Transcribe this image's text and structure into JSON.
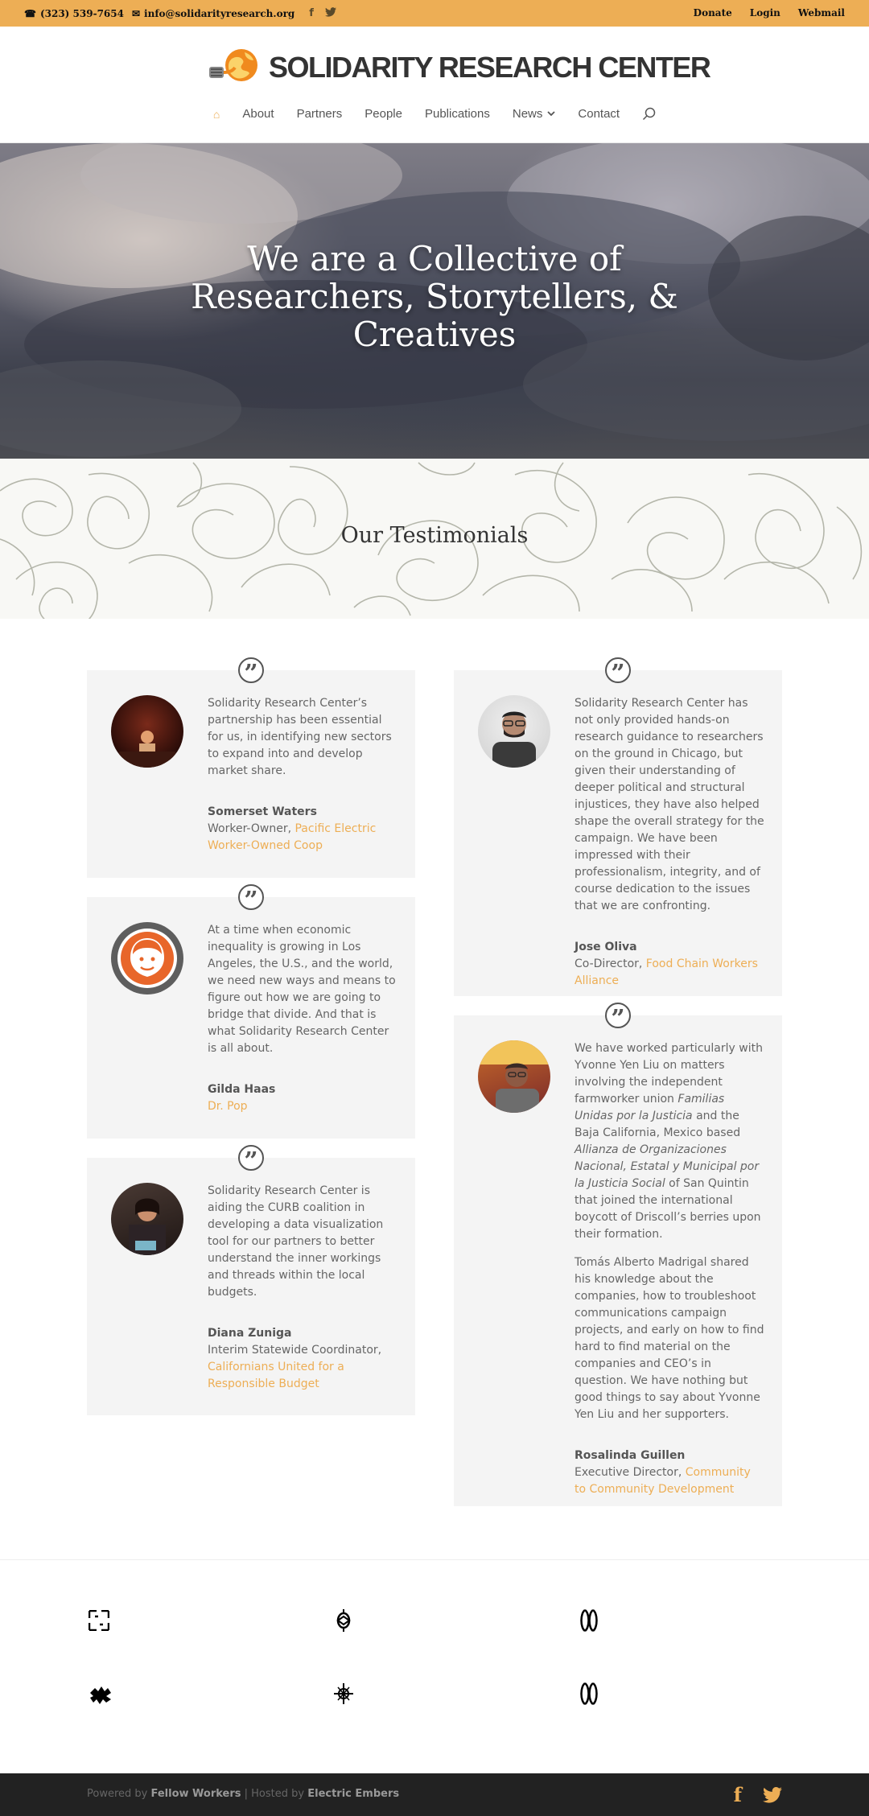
{
  "topbar": {
    "phone": "(323) 539-7654",
    "email": "info@solidarityresearch.org",
    "links": {
      "donate": "Donate",
      "login": "Login",
      "webmail": "Webmail"
    }
  },
  "logo": {
    "text": "SOLIDARITY RESEARCH CENTER",
    "icon": "lightbulb-globe-icon"
  },
  "nav": {
    "home_icon": "home-icon",
    "items": [
      "About",
      "Partners",
      "People",
      "Publications",
      "News",
      "Contact"
    ],
    "search_icon": "search-icon"
  },
  "hero": {
    "line1": "We are a Collective of",
    "line2": "Researchers, Storytellers, &",
    "line3": "Creatives"
  },
  "section_title": "Our Testimonials",
  "testimonials": [
    {
      "quote": "Solidarity Research Center’s partnership has been essential for us, in identifying new sectors to expand into and develop market share.",
      "name": "Somerset Waters",
      "role": "Worker-Owner, ",
      "org": "Pacific Electric Worker-Owned Coop"
    },
    {
      "quote": "At a time when economic inequality is growing in Los Angeles, the U.S., and the world, we need new ways and means to figure out how we are going to bridge that divide.  And that is what Solidarity Research Center is all about.",
      "name": "Gilda Haas",
      "role": "",
      "org": "Dr. Pop"
    },
    {
      "quote": "Solidarity Research Center is aiding the CURB coalition in developing a data visualization tool for our partners to better understand the inner workings and threads within the local budgets.",
      "name": "Diana Zuniga",
      "role": "Interim Statewide Coordinator, ",
      "org": "Californians United for a Responsible Budget"
    },
    {
      "quote": "Solidarity Research Center has not only provided hands-on research guidance to researchers on the ground in Chicago, but given their understanding of deeper political and structural injustices, they have also helped shape the overall strategy for the campaign.  We have been impressed with their professionalism, integrity, and of course dedication to the issues that we are confronting.",
      "name": "Jose Oliva",
      "role": "Co-Director, ",
      "org": "Food Chain Workers Alliance"
    },
    {
      "quote_part1": "We have worked particularly with Yvonne Yen Liu on matters involving the independent farmworker union ",
      "quote_em1": "Familias Unidas por la Justicia",
      "quote_part2": " and the Baja California, Mexico based ",
      "quote_em2": "Allianza de Organizaciones Nacional, Estatal y Municipal por la Justicia Social",
      "quote_part3": " of San Quintin that joined the international boycott of Driscoll’s berries upon their formation.",
      "quote2": "Tomás Alberto Madrigal shared his knowledge about the companies, how to troubleshoot communications campaign projects, and early on how to find hard to find material on the companies and CEO’s in question.  We have nothing but good things to say about Yvonne Yen Liu and her supporters.",
      "name": "Rosalinda Guillen",
      "role": "Executive Director, ",
      "org": "Community to Community Development"
    }
  ],
  "footer": {
    "powered_by": "Powered by ",
    "fellow": "Fellow Workers",
    "sep": " | Hosted by ",
    "hosted": "Electric Embers",
    "social": [
      "facebook-icon",
      "twitter-icon"
    ]
  },
  "colors": {
    "accent": "#edae55",
    "footer_bg": "#222222",
    "card_bg": "#f4f4f4"
  }
}
